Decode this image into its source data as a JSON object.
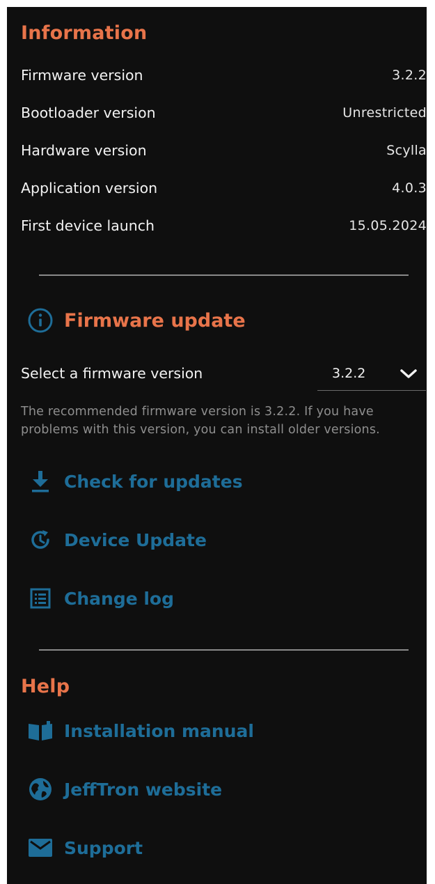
{
  "information": {
    "title": "Information",
    "rows": [
      {
        "label": "Firmware version",
        "value": "3.2.2"
      },
      {
        "label": "Bootloader version",
        "value": "Unrestricted"
      },
      {
        "label": "Hardware version",
        "value": "Scylla"
      },
      {
        "label": "Application version",
        "value": "4.0.3"
      },
      {
        "label": "First device launch",
        "value": "15.05.2024"
      }
    ]
  },
  "firmware_update": {
    "title": "Firmware update",
    "icon": "info-icon",
    "select_label": "Select a firmware version",
    "selected_version": "3.2.2",
    "note": "The recommended firmware version is 3.2.2. If you have problems with this version, you can install older versions.",
    "actions": [
      {
        "label": "Check for updates",
        "icon": "download-icon"
      },
      {
        "label": "Device Update",
        "icon": "update-icon"
      },
      {
        "label": "Change log",
        "icon": "list-icon"
      }
    ]
  },
  "help": {
    "title": "Help",
    "links": [
      {
        "label": "Installation manual",
        "icon": "book-icon"
      },
      {
        "label": "JeffTron website",
        "icon": "globe-icon"
      },
      {
        "label": "Support",
        "icon": "mail-icon"
      }
    ]
  },
  "colors": {
    "background": "#0f0f0f",
    "accent_orange": "#e8744a",
    "link_blue": "#1e6d98",
    "text": "#f2f2f2",
    "muted": "#8e8e8e"
  }
}
